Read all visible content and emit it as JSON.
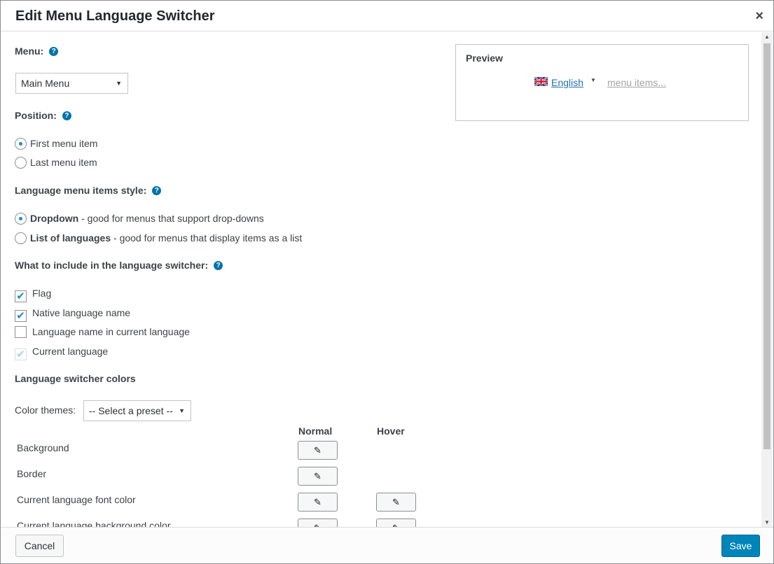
{
  "dialog": {
    "title": "Edit Menu Language Switcher",
    "close_glyph": "×"
  },
  "menu": {
    "label": "Menu:",
    "selected": "Main Menu"
  },
  "position": {
    "label": "Position:",
    "options": [
      {
        "label": "First menu item",
        "checked": true
      },
      {
        "label": "Last menu item",
        "checked": false
      }
    ]
  },
  "style": {
    "label": "Language menu items style:",
    "options": [
      {
        "name": "Dropdown",
        "desc": " - good for menus that support drop-downs",
        "checked": true
      },
      {
        "name": "List of languages",
        "desc": " - good for menus that display items as a list",
        "checked": false
      }
    ]
  },
  "include": {
    "label": "What to include in the language switcher:",
    "options": [
      {
        "label": "Flag",
        "checked": true,
        "disabled": false
      },
      {
        "label": "Native language name",
        "checked": true,
        "disabled": false
      },
      {
        "label": "Language name in current language",
        "checked": false,
        "disabled": false
      },
      {
        "label": "Current language",
        "checked": true,
        "disabled": true
      }
    ]
  },
  "colors": {
    "label": "Language switcher colors",
    "themes_label": "Color themes:",
    "themes_selected": "-- Select a preset --",
    "col_normal": "Normal",
    "col_hover": "Hover",
    "rows": [
      {
        "label": "Background"
      },
      {
        "label": "Border"
      },
      {
        "label": "Current language font color"
      },
      {
        "label": "Current language background color"
      }
    ]
  },
  "preview": {
    "title": "Preview",
    "language": "English",
    "menu_items": "menu items..."
  },
  "footer": {
    "cancel": "Cancel",
    "save": "Save"
  },
  "icons": {
    "help": "help-icon",
    "pick": "pencil-icon",
    "flag": "uk-flag-icon"
  },
  "theme": {
    "accent": "#0085ba",
    "link": "#2271b1",
    "help": "#0073aa"
  }
}
